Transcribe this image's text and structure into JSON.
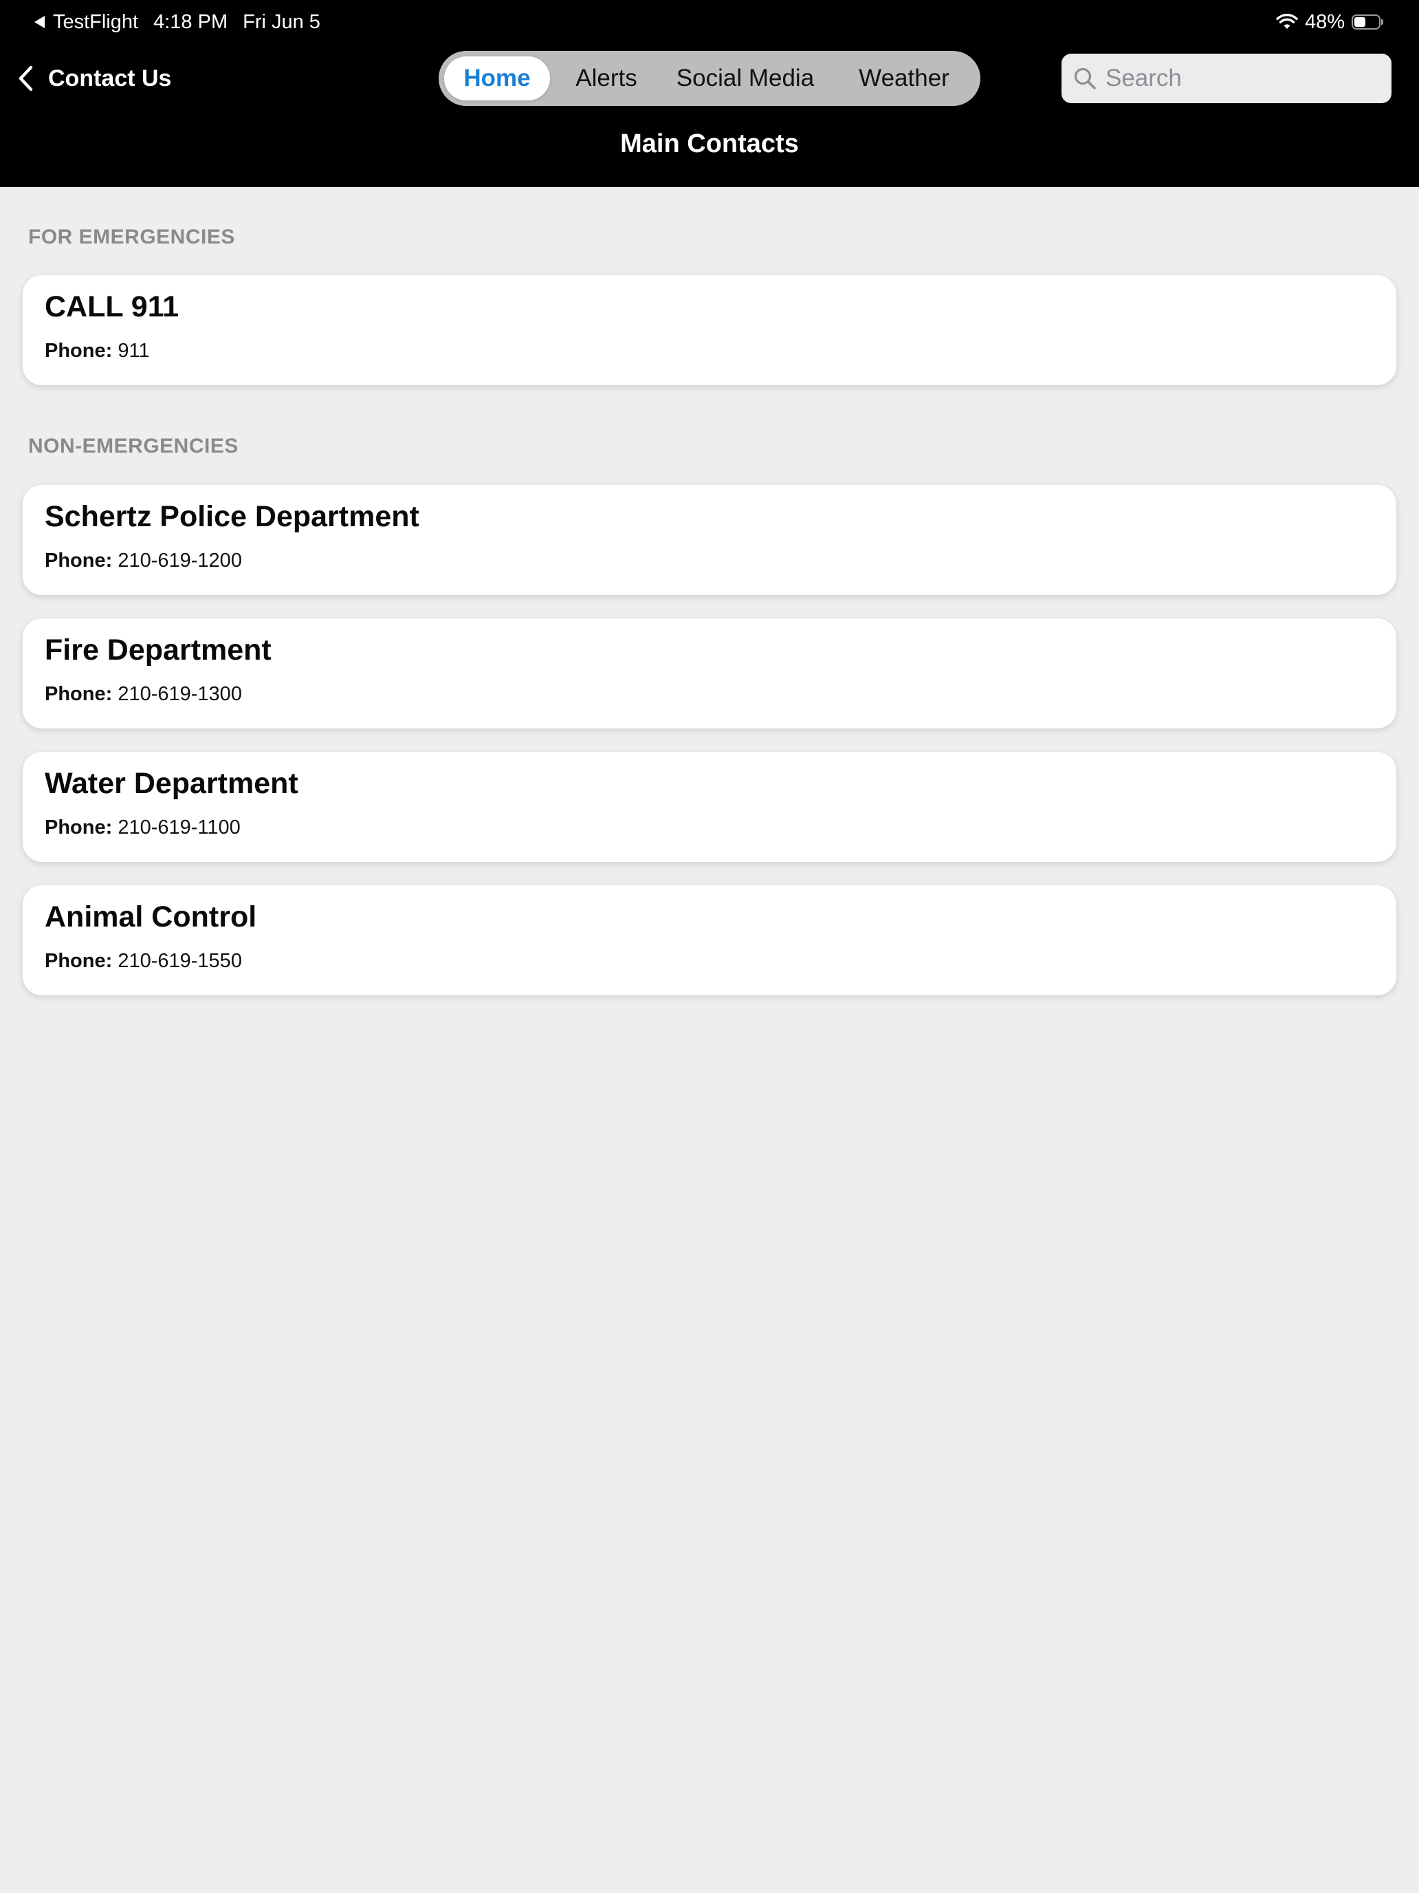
{
  "status_bar": {
    "back_app": "TestFlight",
    "time": "4:18 PM",
    "date": "Fri Jun 5",
    "battery_percent": "48%",
    "battery_level": 0.48
  },
  "nav": {
    "back_label": "Contact Us",
    "title": "Main Contacts",
    "segments": [
      "Home",
      "Alerts",
      "Social Media",
      "Weather"
    ],
    "selected_segment": "Home",
    "accent_color": "#1a7fd6"
  },
  "search": {
    "placeholder": "Search"
  },
  "sections": [
    {
      "header": "FOR EMERGENCIES",
      "contacts": [
        {
          "name": "CALL 911",
          "phone_label": "Phone:",
          "phone": "911"
        }
      ]
    },
    {
      "header": "NON-EMERGENCIES",
      "contacts": [
        {
          "name": "Schertz Police Department",
          "phone_label": "Phone:",
          "phone": "210-619-1200"
        },
        {
          "name": "Fire Department",
          "phone_label": "Phone:",
          "phone": "210-619-1300"
        },
        {
          "name": "Water Department",
          "phone_label": "Phone:",
          "phone": "210-619-1100"
        },
        {
          "name": "Animal Control",
          "phone_label": "Phone:",
          "phone": "210-619-1550"
        }
      ]
    }
  ],
  "icons": {
    "back_app": "back-triangle-icon",
    "wifi": "wifi-icon",
    "battery": "battery-icon",
    "back": "chevron-left-icon",
    "search": "search-icon"
  }
}
